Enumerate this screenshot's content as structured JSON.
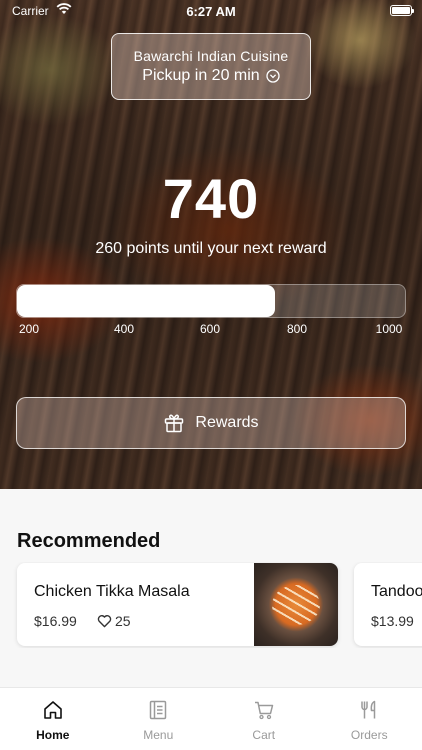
{
  "status_bar": {
    "carrier": "Carrier",
    "time": "6:27 AM"
  },
  "location": {
    "restaurant": "Bawarchi Indian Cuisine",
    "pickup": "Pickup in 20 min",
    "icon": "chevron-down-circle-icon"
  },
  "loyalty": {
    "points": "740",
    "points_value": 740,
    "subtitle": "260 points until your next reward",
    "scale_min": 200,
    "scale_max": 1000,
    "ticks": [
      "200",
      "400",
      "600",
      "800",
      "1000"
    ]
  },
  "rewards_button": {
    "label": "Rewards",
    "icon": "gift-icon"
  },
  "recommended": {
    "title": "Recommended",
    "items": [
      {
        "name": "Chicken Tikka Masala",
        "price": "$16.99",
        "likes": "25"
      },
      {
        "name": "Tandoori",
        "price": "$13.99"
      }
    ]
  },
  "tabbar": {
    "tabs": [
      {
        "label": "Home",
        "icon": "home-icon",
        "active": true
      },
      {
        "label": "Menu",
        "icon": "menu-icon",
        "active": false
      },
      {
        "label": "Cart",
        "icon": "cart-icon",
        "active": false
      },
      {
        "label": "Orders",
        "icon": "fork-knife-icon",
        "active": false
      }
    ]
  },
  "colors": {
    "active_tab": "#111111",
    "inactive_tab": "#9a9a9a",
    "progress": "#ffffff"
  }
}
